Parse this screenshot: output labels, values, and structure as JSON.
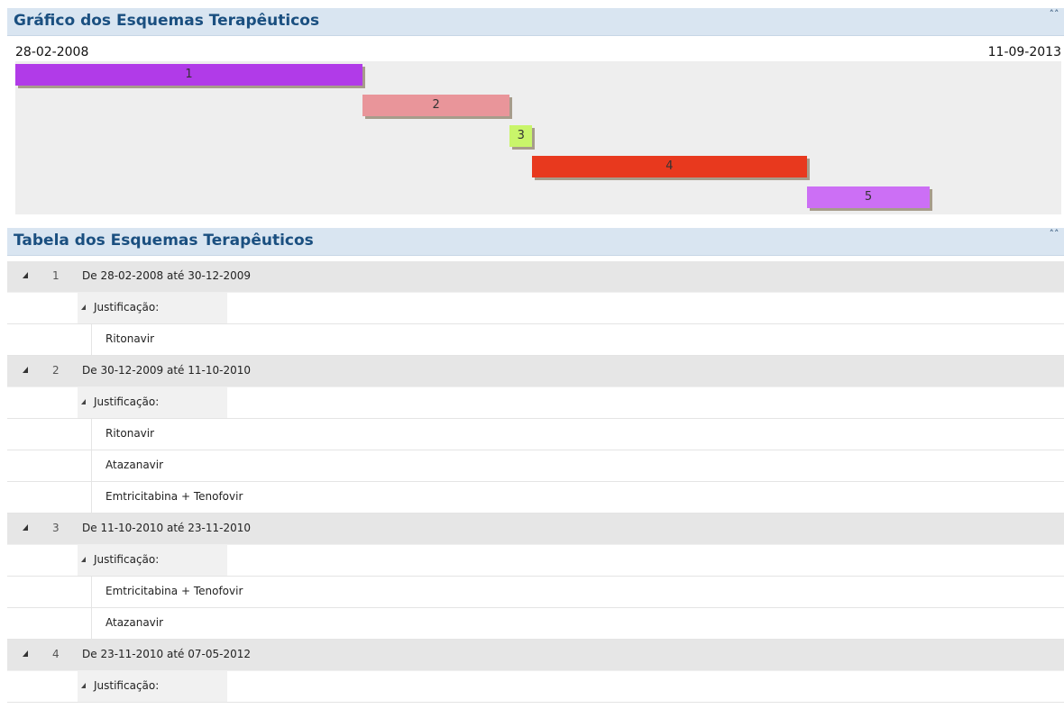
{
  "chart_panel": {
    "title": "Gráfico dos Esquemas Terapêuticos",
    "collapse": "˄˄"
  },
  "chart_data": {
    "type": "gantt",
    "start_label": "28-02-2008",
    "end_label": "11-09-2013",
    "start": "2008-02-28",
    "end": "2013-09-11",
    "bars": [
      {
        "label": "1",
        "start": "2008-02-28",
        "end": "2009-12-30",
        "color": "#b13be8"
      },
      {
        "label": "2",
        "start": "2009-12-30",
        "end": "2010-10-11",
        "color": "#e9959a"
      },
      {
        "label": "3",
        "start": "2010-10-11",
        "end": "2010-11-23",
        "color": "#c9f56a"
      },
      {
        "label": "4",
        "start": "2010-11-23",
        "end": "2012-05-07",
        "color": "#e8391e"
      },
      {
        "label": "5",
        "start": "2012-05-07",
        "end": "2012-12-31",
        "color": "#cc6ff5"
      }
    ]
  },
  "table_panel": {
    "title": "Tabela dos Esquemas Terapêuticos",
    "collapse": "˄˄"
  },
  "schemes": [
    {
      "num": "1",
      "range": "De 28-02-2008 até 30-12-2009",
      "just": "Justificação:",
      "drugs": [
        "Ritonavir"
      ]
    },
    {
      "num": "2",
      "range": "De 30-12-2009 até 11-10-2010",
      "just": "Justificação:",
      "drugs": [
        "Ritonavir",
        "Atazanavir",
        "Emtricitabina + Tenofovir"
      ]
    },
    {
      "num": "3",
      "range": "De 11-10-2010 até 23-11-2010",
      "just": "Justificação:",
      "drugs": [
        "Emtricitabina + Tenofovir",
        "Atazanavir"
      ]
    },
    {
      "num": "4",
      "range": "De 23-11-2010 até 07-05-2012",
      "just": "Justificação:",
      "drugs": []
    }
  ]
}
